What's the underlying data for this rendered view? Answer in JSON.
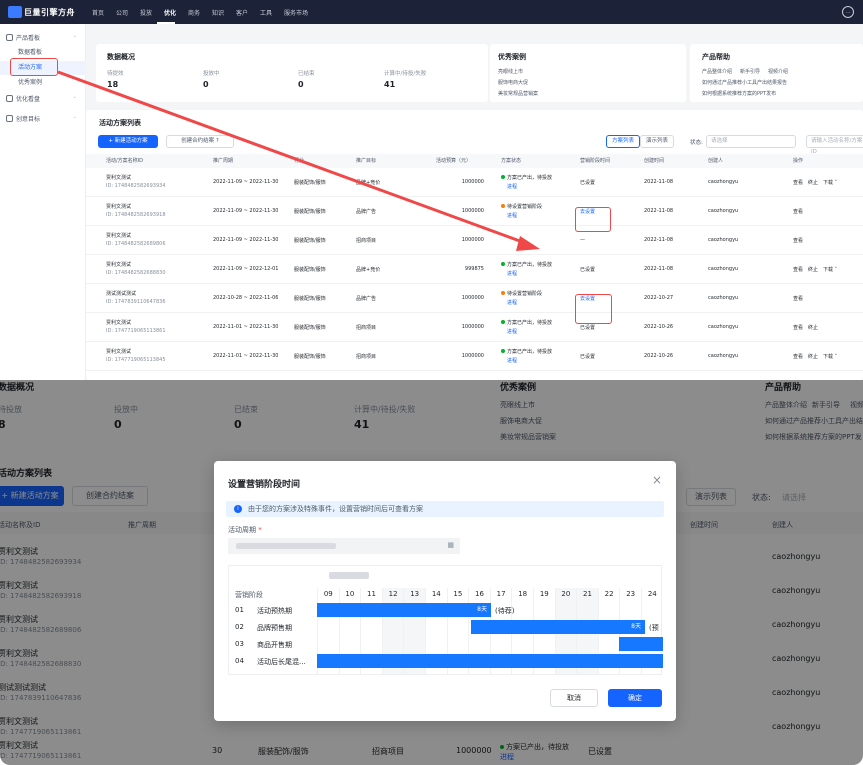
{
  "app": {
    "logo_text": "巨量引擎方舟",
    "nav": [
      "首页",
      "公司",
      "投放",
      "优化",
      "商务",
      "知识",
      "客户",
      "工具",
      "服务市场"
    ],
    "active_nav": "优化",
    "user_initials": "..."
  },
  "sidebar": {
    "items": [
      {
        "label": "产品看板",
        "type": "group"
      },
      {
        "label": "数据看板",
        "type": "sub"
      },
      {
        "label": "活动方案",
        "type": "sub",
        "selected": true
      },
      {
        "label": "优秀案例",
        "type": "sub"
      },
      {
        "label": "优化看盘",
        "type": "group"
      },
      {
        "label": "创意目标",
        "type": "group"
      }
    ]
  },
  "overview": {
    "title": "数据概况",
    "stats": [
      {
        "label": "待提效",
        "value": "18"
      },
      {
        "label": "投放中",
        "value": "0"
      },
      {
        "label": "已结束",
        "value": "0"
      },
      {
        "label": "计算中/待投/失败",
        "value": "41"
      }
    ]
  },
  "overview_bottom": {
    "title": "数据概况",
    "stats": [
      {
        "label": "待投放",
        "value": "8"
      },
      {
        "label": "投放中",
        "value": "0"
      },
      {
        "label": "已结束",
        "value": "0"
      },
      {
        "label": "计算中/待投/失败",
        "value": "41"
      }
    ]
  },
  "cases": {
    "title": "优秀案例",
    "items": [
      "亮眼线上市",
      "服饰电商大促",
      "美妆常规品营销案"
    ]
  },
  "cases_bottom": {
    "title": "优秀案例",
    "items": [
      "亮眼线上市",
      "服饰电商大促",
      "美妆常规品营销案"
    ]
  },
  "help": {
    "title": "产品帮助",
    "items": [
      "产品整体介绍",
      "新手引导",
      "视频介绍",
      "如何通过产品推荐小工具产出结果报告",
      "如何根据系统推荐方案的PPT发布"
    ]
  },
  "help_bottom": {
    "title": "产品帮助",
    "items": [
      "产品整体介绍",
      "新手引导",
      "视频",
      "如何通过产品推荐小工具产出结果",
      "如何根据系统推荐方案的PPT发"
    ]
  },
  "plans": {
    "title": "活动方案列表",
    "new_btn": "+ 新建活动方案",
    "contract_btn": "创建合约结案",
    "view_list": "方案列表",
    "view_demo": "演示列表",
    "status_label": "状态:",
    "status_placeholder": "请选择",
    "search_placeholder": "请输入活动名称/方案ID",
    "columns": [
      "活动/方案名称ID",
      "推广周期",
      "行业",
      "推广目标",
      "活动预算（元）",
      "方案状态",
      "营销阶段时间",
      "创建时间",
      "创建人",
      "操作"
    ],
    "rows": [
      {
        "name": "贾利文测试",
        "id": "ID: 1748482582693934",
        "period": "2022-11-09 ~ 2022-11-30",
        "industry": "服装配饰/服饰",
        "goal": "品牌+竞价",
        "budget": "1000000",
        "status": "方案已产出，待投放",
        "status_link": "进程",
        "dot": "#00b42a",
        "phase": "已设置",
        "phase_link": false,
        "created": "2022-11-08",
        "creator": "caozhongyu",
        "ops": [
          "查看",
          "终止",
          "下载 ˅"
        ]
      },
      {
        "name": "贾利文测试",
        "id": "ID: 1748482582693918",
        "period": "2022-11-09 ~ 2022-11-30",
        "industry": "服装配饰/服饰",
        "goal": "品牌广告",
        "budget": "1000000",
        "status": "待设置营销阶段",
        "status_link": "进程",
        "dot": "#ff7d00",
        "phase": "去设置",
        "phase_link": true,
        "created": "2022-11-08",
        "creator": "caozhongyu",
        "ops": [
          "查看"
        ]
      },
      {
        "name": "贾利文测试",
        "id": "ID: 1748482582689806",
        "period": "2022-11-09 ~ 2022-11-30",
        "industry": "服装配饰/服饰",
        "goal": "招商项目",
        "budget": "1000000",
        "status": "",
        "status_link": "",
        "dot": "",
        "phase": "—",
        "phase_link": false,
        "created": "2022-11-08",
        "creator": "caozhongyu",
        "ops": [
          "查看"
        ]
      },
      {
        "name": "贾利文测试",
        "id": "ID: 1748482582688830",
        "period": "2022-11-09 ~ 2022-12-01",
        "industry": "服装配饰/服饰",
        "goal": "品牌+竞价",
        "budget": "999875",
        "status": "方案已产出，待投放",
        "status_link": "进程",
        "dot": "#00b42a",
        "phase": "已设置",
        "phase_link": false,
        "created": "2022-11-08",
        "creator": "caozhongyu",
        "ops": [
          "查看",
          "终止",
          "下载 ˅"
        ]
      },
      {
        "name": "测试测试测试",
        "id": "ID: 1747839110647836",
        "period": "2022-10-28 ~ 2022-11-06",
        "industry": "服装配饰/服饰",
        "goal": "品牌广告",
        "budget": "1000000",
        "status": "待设置营销阶段",
        "status_link": "进程",
        "dot": "#ff7d00",
        "phase": "去设置",
        "phase_link": true,
        "created": "2022-10-27",
        "creator": "caozhongyu",
        "ops": [
          "查看"
        ]
      },
      {
        "name": "贾利文测试",
        "id": "ID: 1747719065113861",
        "period": "2022-11-01 ~ 2022-11-30",
        "industry": "服装配饰/服饰",
        "goal": "招商项目",
        "budget": "1000000",
        "status": "方案已产出，待投放",
        "status_link": "进程",
        "dot": "#00b42a",
        "phase": "已设置",
        "phase_link": false,
        "created": "2022-10-26",
        "creator": "caozhongyu",
        "ops": [
          "查看",
          "终止"
        ]
      },
      {
        "name": "贾利文测试",
        "id": "ID: 1747719065113845",
        "period": "2022-11-01 ~ 2022-11-30",
        "industry": "服装配饰/服饰",
        "goal": "招商项目",
        "budget": "1000000",
        "status": "方案已产出，待投放",
        "status_link": "进程",
        "dot": "#00b42a",
        "phase": "已设置",
        "phase_link": false,
        "created": "2022-10-26",
        "creator": "caozhongyu",
        "ops": [
          "查看",
          "终止",
          "下载 ˅"
        ]
      }
    ]
  },
  "bottom_list": {
    "title": "活动方案列表",
    "new_btn": "+ 新建活动方案",
    "contract_btn": "创建合约结案",
    "col_name": "活动名称及ID",
    "col_period": "推广周期",
    "col_created": "创建时间",
    "col_creator": "创建人",
    "demo": "演示列表",
    "status_label": "状态:",
    "status_placeholder": "请选择",
    "rows": [
      {
        "name": "贾利文测试",
        "id": "ID: 1748482582693934",
        "creator": "caozhongyu"
      },
      {
        "name": "贾利文测试",
        "id": "ID: 1748482582693918",
        "creator": "caozhongyu"
      },
      {
        "name": "贾利文测试",
        "id": "ID: 1748482582689806",
        "creator": "caozhongyu"
      },
      {
        "name": "贾利文测试",
        "id": "ID: 1748482582688830",
        "creator": "caozhongyu"
      },
      {
        "name": "测试测试测试",
        "id": "ID: 1747839110647836",
        "creator": "caozhongyu"
      },
      {
        "name": "贾利文测试",
        "id": "ID: 1747719065113861",
        "creator": "caozhongyu"
      }
    ],
    "last_row": {
      "period_end": "30",
      "industry": "服装配饰/服饰",
      "goal": "招商项目",
      "budget": "1000000",
      "status": "方案已产出，待投放",
      "status_link": "进程",
      "phase": "已设置"
    }
  },
  "modal": {
    "title": "设置营销阶段时间",
    "close": "×",
    "notice": "由于您的方案涉及特殊事件，设置营销时间后可查看方案",
    "period_label": "活动周期",
    "required": "*",
    "period_value": "",
    "month_label": "",
    "stage_header": "营销阶段",
    "days": [
      "09",
      "10",
      "11",
      "12",
      "13",
      "14",
      "15",
      "16",
      "17",
      "18",
      "19",
      "20",
      "21",
      "22",
      "23",
      "24"
    ],
    "stages": [
      {
        "num": "01",
        "name": "活动预热期",
        "bar_label": "8天",
        "note": "(待荐)"
      },
      {
        "num": "02",
        "name": "品牌预售期",
        "bar_label": "8天",
        "note": "(预"
      },
      {
        "num": "03",
        "name": "商品开售期",
        "bar_label": "",
        "note": ""
      },
      {
        "num": "04",
        "name": "活动后长尾混...",
        "bar_label": "",
        "note": ""
      }
    ],
    "cancel": "取消",
    "confirm": "确定"
  },
  "colors": {
    "primary": "#1664ff",
    "annotation_red": "#f04848",
    "topbar": "#1c2238"
  }
}
